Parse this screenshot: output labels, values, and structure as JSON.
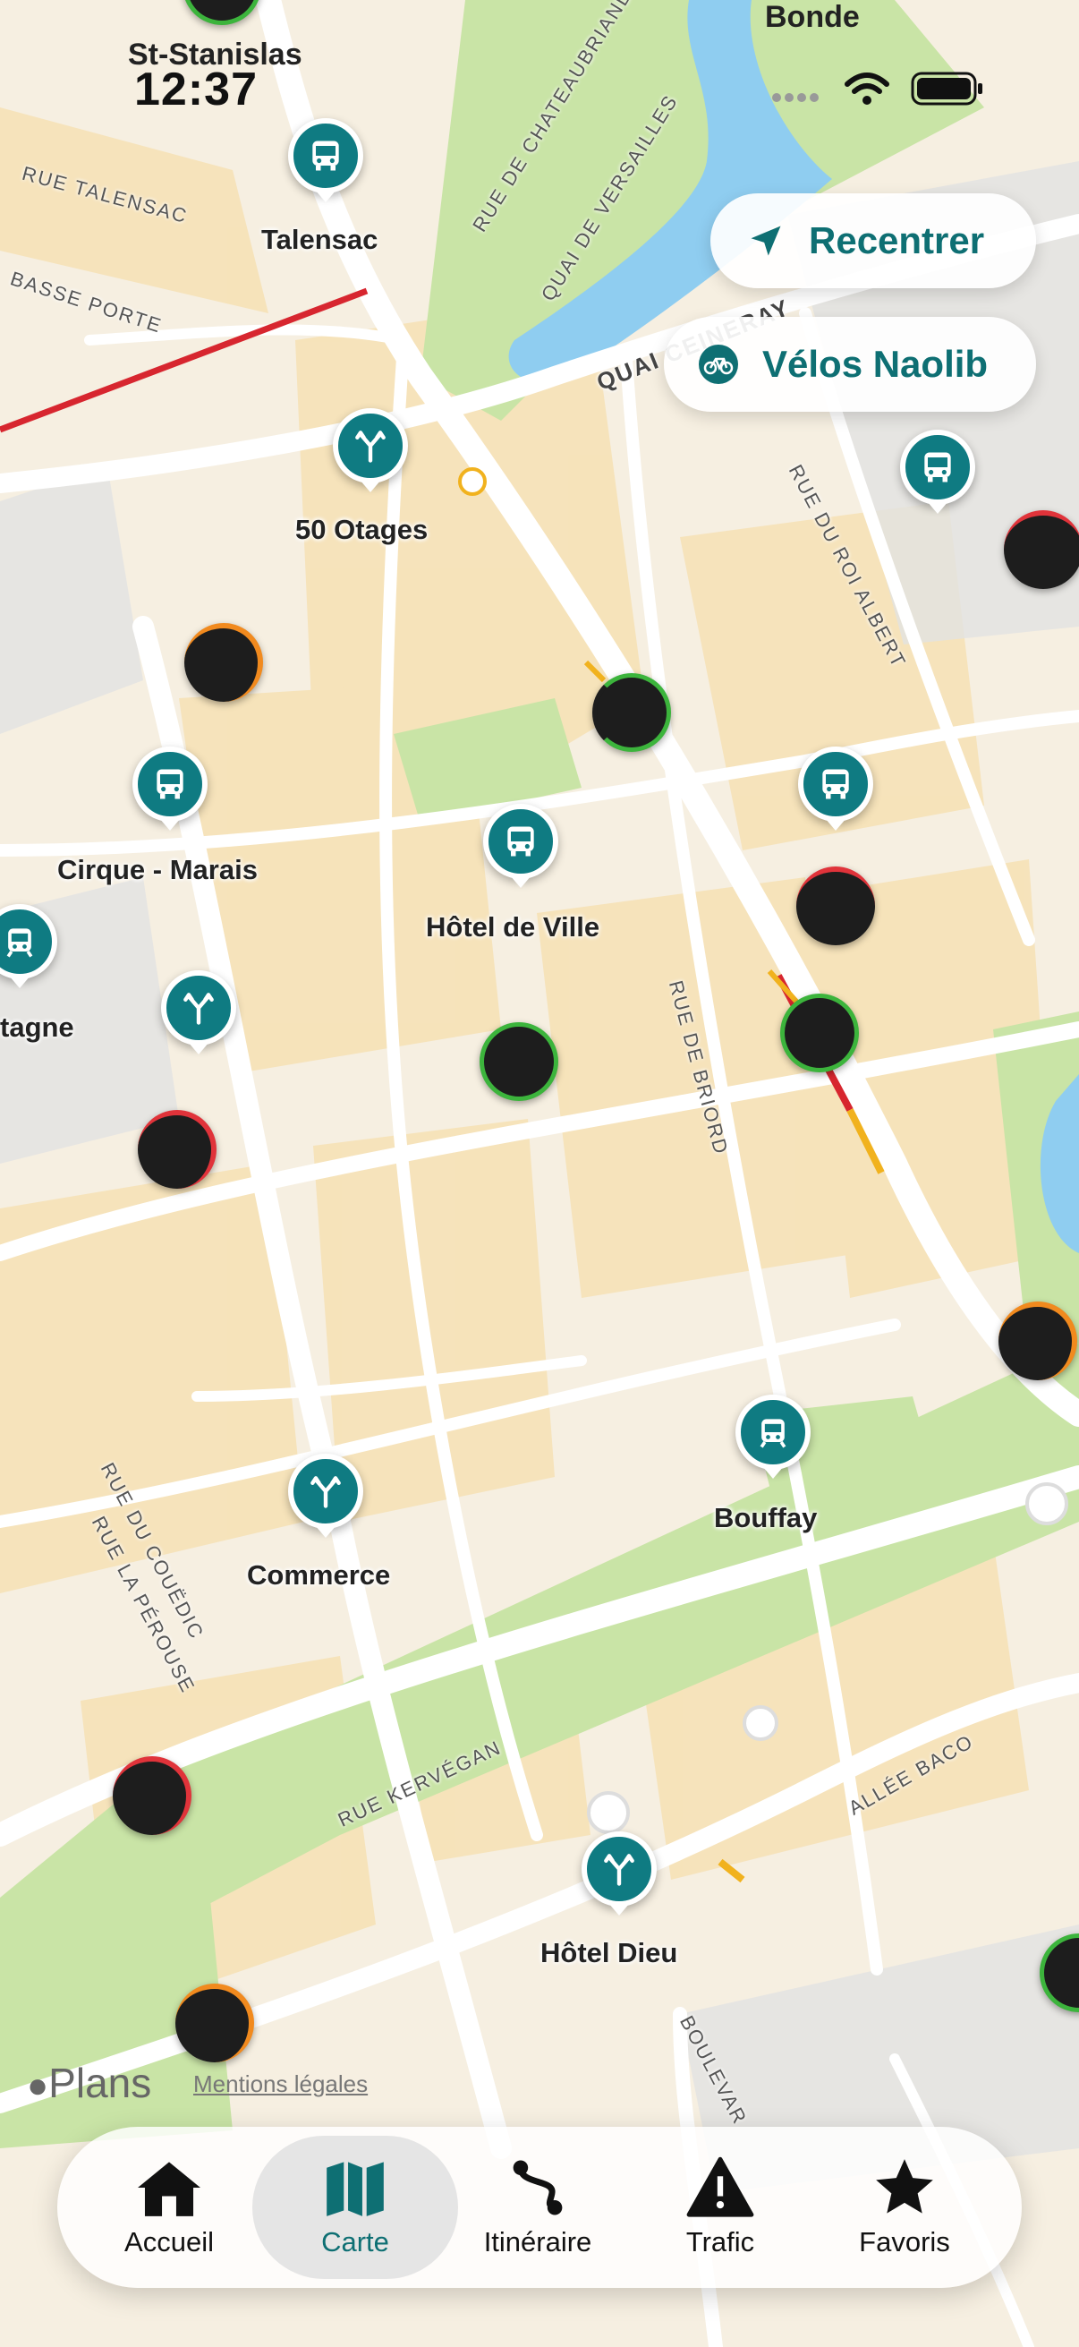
{
  "status_bar": {
    "time": "12:37"
  },
  "buttons": {
    "recenter": "Recentrer",
    "bikes": "Vélos Naolib"
  },
  "map": {
    "place_labels": {
      "st_stanislas": "St-Stanislas",
      "bonde": "Bonde",
      "talensac": "Talensac",
      "otages": "50 Otages",
      "cirque_marais": "Cirque - Marais",
      "hotel_de_ville": "Hôtel de Ville",
      "bretagne": "tagne",
      "bouffay": "Bouffay",
      "commerce": "Commerce",
      "hotel_dieu": "Hôtel Dieu"
    },
    "street_labels": {
      "talensac": "RUE TALENSAC",
      "basse_porte": "BASSE PORTE",
      "chateaubriand": "RUE DE CHATEAUBRIAND",
      "versailles": "QUAI DE VERSAILLES",
      "quai_ceineray": "QUAI CEINERAY",
      "roi_albert": "RUE DU ROI ALBERT",
      "briord": "RUE DE BRIORD",
      "couedic": "RUE DU COUËDIC",
      "la_perouse": "RUE LA PÉROUSE",
      "kervegan": "RUE KERVÉGAN",
      "allee_baco": "ALLÉE BACO",
      "boulevard": "BOULEVAR"
    },
    "attribution": {
      "brand": "Plans",
      "legal": "Mentions légales"
    }
  },
  "tabbar": {
    "tabs": [
      {
        "label": "Accueil",
        "icon": "house-icon"
      },
      {
        "label": "Carte",
        "icon": "map-icon",
        "active": true
      },
      {
        "label": "Itinéraire",
        "icon": "route-icon"
      },
      {
        "label": "Trafic",
        "icon": "warning-icon"
      },
      {
        "label": "Favoris",
        "icon": "star-icon"
      }
    ]
  },
  "colors": {
    "accent": "#0f7b82",
    "station": "#1d1d1d",
    "tram_line": "#d7262f",
    "orange": "#f18a1e",
    "green": "#3cb43c",
    "red": "#e0333a"
  }
}
